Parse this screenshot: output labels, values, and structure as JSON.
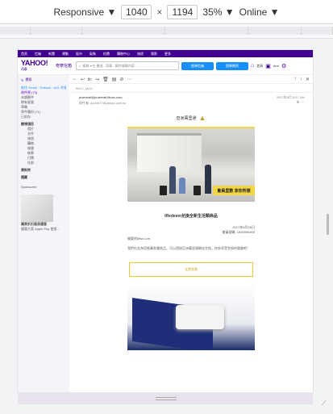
{
  "devtools": {
    "device_label": "Responsive ▼",
    "width": "1040",
    "times": "×",
    "height": "1194",
    "zoom": "35% ▼",
    "network": "Online ▼"
  },
  "yahoo": {
    "nav": [
      "首頁",
      "信箱",
      "新聞",
      "運動",
      "股市",
      "氣象",
      "拍賣",
      "購物中心",
      "旅遊",
      "電影",
      "更多"
    ],
    "logo": "YAHOO!",
    "logo_sub": "奇摩",
    "product": "奇摩信箱",
    "search_placeholder": "搜尋 ▾  在 雅虎 · 奇摩 · 郵件搜尋內容",
    "search_mail_btn": "搜尋信箱",
    "search_web_btn": "搜尋網頁",
    "home_label": "首頁",
    "user_label": "Ann"
  },
  "sidebar": {
    "compose": "撰寫",
    "items": [
      {
        "label": "前往 Gmail · Outlook · AOL 的電子郵件",
        "cls": "blue"
      },
      {
        "label": "收件匣 (73)",
        "cls": "purple"
      },
      {
        "label": "未讀郵件",
        "cls": ""
      },
      {
        "label": "帶有星號",
        "cls": ""
      },
      {
        "label": "草稿",
        "cls": ""
      },
      {
        "label": "寄件備份 (71)",
        "cls": ""
      },
      {
        "label": "已封存",
        "cls": ""
      }
    ],
    "section1": "檢視項目",
    "sub_items": [
      "相片",
      "文件",
      "旅遊",
      "購物",
      "收據",
      "帳單",
      "付費",
      "社群"
    ],
    "section2": "資料夾",
    "section3": "隱藏",
    "ad_label": "Sponsored",
    "ad_title": "購買折扣最高優惠",
    "ad_text": "優惠方案 Apple Pay 使用..."
  },
  "mail": {
    "subject_hint": "BWO_MAIL",
    "from": "putemail@putemail.fitnux.com",
    "to": "收件者: you4672@yahoo.com.tw",
    "date": "2017年6月 8:47 AM",
    "brand": "亞洲萬里通",
    "hero_banner": "會員里數 享你所想",
    "headline": "iRedeem兌換全新生活類商品",
    "date_line": "2017年6月26日",
    "member_line": "會員號碼: 1520000000",
    "greeting": "親愛的Miss Lee,",
    "para": "我們在此為您推薦各種商品，可以透過亞洲萬里通網站兌換，快來享受兌換的樂趣吧！",
    "cta": "立即兌換"
  }
}
